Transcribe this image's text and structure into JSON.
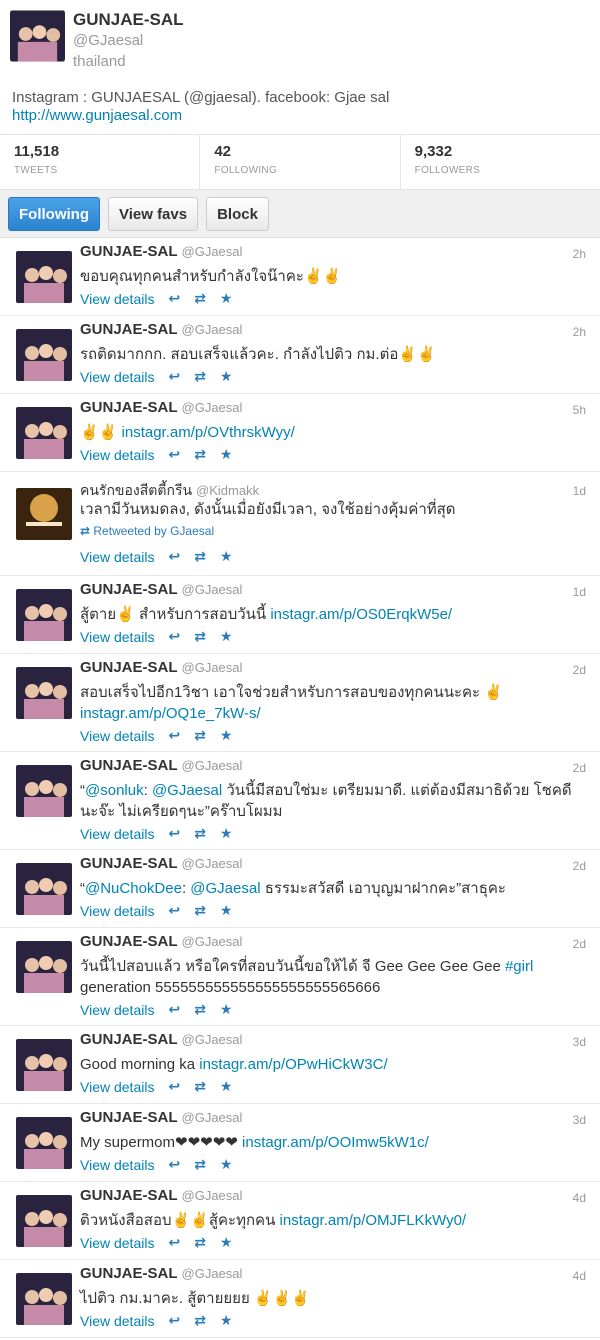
{
  "profile": {
    "name": "GUNJAE-SAL",
    "handle": "@GJaesal",
    "location": "thailand",
    "bio": "Instagram : GUNJAESAL (@gjaesal). facebook: Gjae sal",
    "url": "http://www.gunjaesal.com"
  },
  "stats": {
    "tweets": {
      "count": "11,518",
      "label": "TWEETS"
    },
    "following": {
      "count": "42",
      "label": "FOLLOWING"
    },
    "followers": {
      "count": "9,332",
      "label": "FOLLOWERS"
    }
  },
  "actions": {
    "following": "Following",
    "view_favs": "View favs",
    "block": "Block"
  },
  "footer_labels": {
    "view_details": "View details",
    "reply_icon": "reply-icon",
    "retweet_icon": "retweet-icon",
    "favorite_icon": "star-icon"
  },
  "colors": {
    "accent": "#0084b4",
    "button_blue": "#2b83cf"
  },
  "tweets": [
    {
      "name": "GUNJAE-SAL",
      "handle": "@GJaesal",
      "time": "2h",
      "text": "ขอบคุณทุกคนสำหรับกำลังใจน๊าคะ✌️✌️"
    },
    {
      "name": "GUNJAE-SAL",
      "handle": "@GJaesal",
      "time": "2h",
      "text": "รถติดมากกก. สอบเสร็จแล้วคะ. กำลังไปติว กม.ต่อ✌️✌️"
    },
    {
      "name": "GUNJAE-SAL",
      "handle": "@GJaesal",
      "time": "5h",
      "pre": "✌️✌️ ",
      "link": "instagr.am/p/OVthrskWyy/"
    },
    {
      "name": "คนรักของสีตตี้กรีน",
      "handle": "@Kidmakk",
      "time": "1d",
      "text": "เวลามีวันหมดลง, ดังนั้นเมื่อยังมีเวลา, จงใช้อย่างคุ้มค่าที่สุด",
      "retweeted": "Retweeted by GJaesal"
    },
    {
      "name": "GUNJAE-SAL",
      "handle": "@GJaesal",
      "time": "1d",
      "pre": "สู้ตาย✌️ สำหรับการสอบวันนี้   ",
      "link": "instagr.am/p/OS0ErqkW5e/"
    },
    {
      "name": "GUNJAE-SAL",
      "handle": "@GJaesal",
      "time": "2d",
      "pre": "สอบเสร็จไปอีก1วิชา เอาใจช่วยสำหรับการสอบของทุกคนนะคะ ✌️ ",
      "link": "instagr.am/p/OQ1e_7kW-s/"
    },
    {
      "name": "GUNJAE-SAL",
      "handle": "@GJaesal",
      "time": "2d",
      "pre": "“",
      "link": "@sonluk",
      "mid": ": ",
      "link2": "@GJaesal",
      "post": " วันนี้มีสอบใช่มะ เตรียมมาดี. แต่ต้องมีสมาธิด้วย โชคดีนะจ๊ะ ไม่เครียดๆนะ”คร๊าบโผมม"
    },
    {
      "name": "GUNJAE-SAL",
      "handle": "@GJaesal",
      "time": "2d",
      "pre": "“",
      "link": "@NuChokDee",
      "mid": ": ",
      "link2": "@GJaesal",
      "post": " ธรรมะสวัสดี เอาบุญมาฝากคะ”สาธุคะ"
    },
    {
      "name": "GUNJAE-SAL",
      "handle": "@GJaesal",
      "time": "2d",
      "pre": "วันนี้ไปสอบแล้ว หรือใครที่สอบวันนี้ขอให้ได้ จี Gee Gee Gee Gee  ",
      "link": "#girl",
      "post": " generation 555555555555555555555565666"
    },
    {
      "name": "GUNJAE-SAL",
      "handle": "@GJaesal",
      "time": "3d",
      "pre": "Good morning ka ",
      "link": "instagr.am/p/OPwHiCkW3C/"
    },
    {
      "name": "GUNJAE-SAL",
      "handle": "@GJaesal",
      "time": "3d",
      "pre": "My supermom❤❤❤❤❤ ",
      "link": "instagr.am/p/OOImw5kW1c/"
    },
    {
      "name": "GUNJAE-SAL",
      "handle": "@GJaesal",
      "time": "4d",
      "pre": "ติวหนังสือสอบ✌️✌️สู้คะทุกคน ",
      "link": "instagr.am/p/OMJFLKkWy0/"
    },
    {
      "name": "GUNJAE-SAL",
      "handle": "@GJaesal",
      "time": "4d",
      "text": "ไปติว กม.มาคะ. สู้ตายยยย ✌️✌️✌️"
    }
  ]
}
